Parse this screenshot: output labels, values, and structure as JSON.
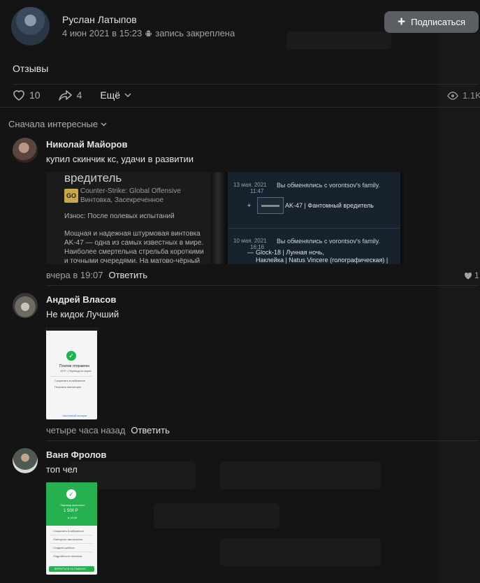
{
  "post": {
    "author": "Руслан Латыпов",
    "date": "4 июн 2021 в 15:23",
    "pinned": "запись закреплена",
    "subscribe_label": "Подписаться",
    "text": "Отзывы",
    "likes": "10",
    "shares": "4",
    "more_label": "Ещё",
    "views": "1.1K"
  },
  "sort_label": "Сначала интересные",
  "comments": [
    {
      "name": "Николай Майоров",
      "text": "купил скинчик кс, удачи в развитии",
      "time": "вчера в 19:07",
      "reply": "Ответить",
      "likes": "1",
      "attachment": {
        "left": {
          "title": "вредитель",
          "logo": "GO",
          "game": "Counter-Strike: Global Offensive",
          "type": "Винтовка, Засекреченное",
          "wear": "Износ: После полевых испытаний",
          "desc": "Мощная и надежная штурмовая винтовка AK-47 — одна из самых известных в мире. Наиболее смертельна стрельба короткими и точными очередями. На матово-чёрный"
        },
        "right": {
          "row1_date": "13 мая. 2021",
          "row1_time": "11:47",
          "row1_title": "Вы обменялись с vorontsov's family.",
          "row1_item": "AK-47 | Фантомный вредитель",
          "row1_sign": "+",
          "row2_date": "10 мая. 2021",
          "row2_time": "16:16",
          "row2_title": "Вы обменялись с vorontsov's family.",
          "row2_item1": "Glock-18 | Лунная ночь,",
          "row2_item2": "Наклейка | Natus Vincere (голографическая) | РМР",
          "row2_sign": "—"
        }
      }
    },
    {
      "name": "Андрей Власов",
      "text": "Не кидок Лучший",
      "time": "четыре часа назад",
      "reply": "Ответить",
      "attachment": {
        "status": "Платеж отправлен",
        "sub": "13 Р • Перевод по карте",
        "opt1": "Сохранить в избранное",
        "opt2": "Показать квитанцию",
        "link": "Частичный возврат"
      }
    },
    {
      "name": "Ваня Фролов",
      "text": "топ чел",
      "attachment": {
        "status": "Перевод выполнен",
        "amount": "1 500 Р",
        "sub": "в 16:08",
        "opt1": "Сохранить в избранное",
        "opt2": "Повторить автоплатеж",
        "opt3": "Создать шаблон",
        "opt4": "Подробности платежа",
        "button": "ВЕРНУТЬСЯ НА ГЛАВНУЮ"
      }
    }
  ],
  "colors": {
    "background": "#141414",
    "text": "#e1e3e6",
    "secondary": "#9ea3a9",
    "subscribe_bg": "#5b5e63",
    "green": "#26b04f"
  }
}
